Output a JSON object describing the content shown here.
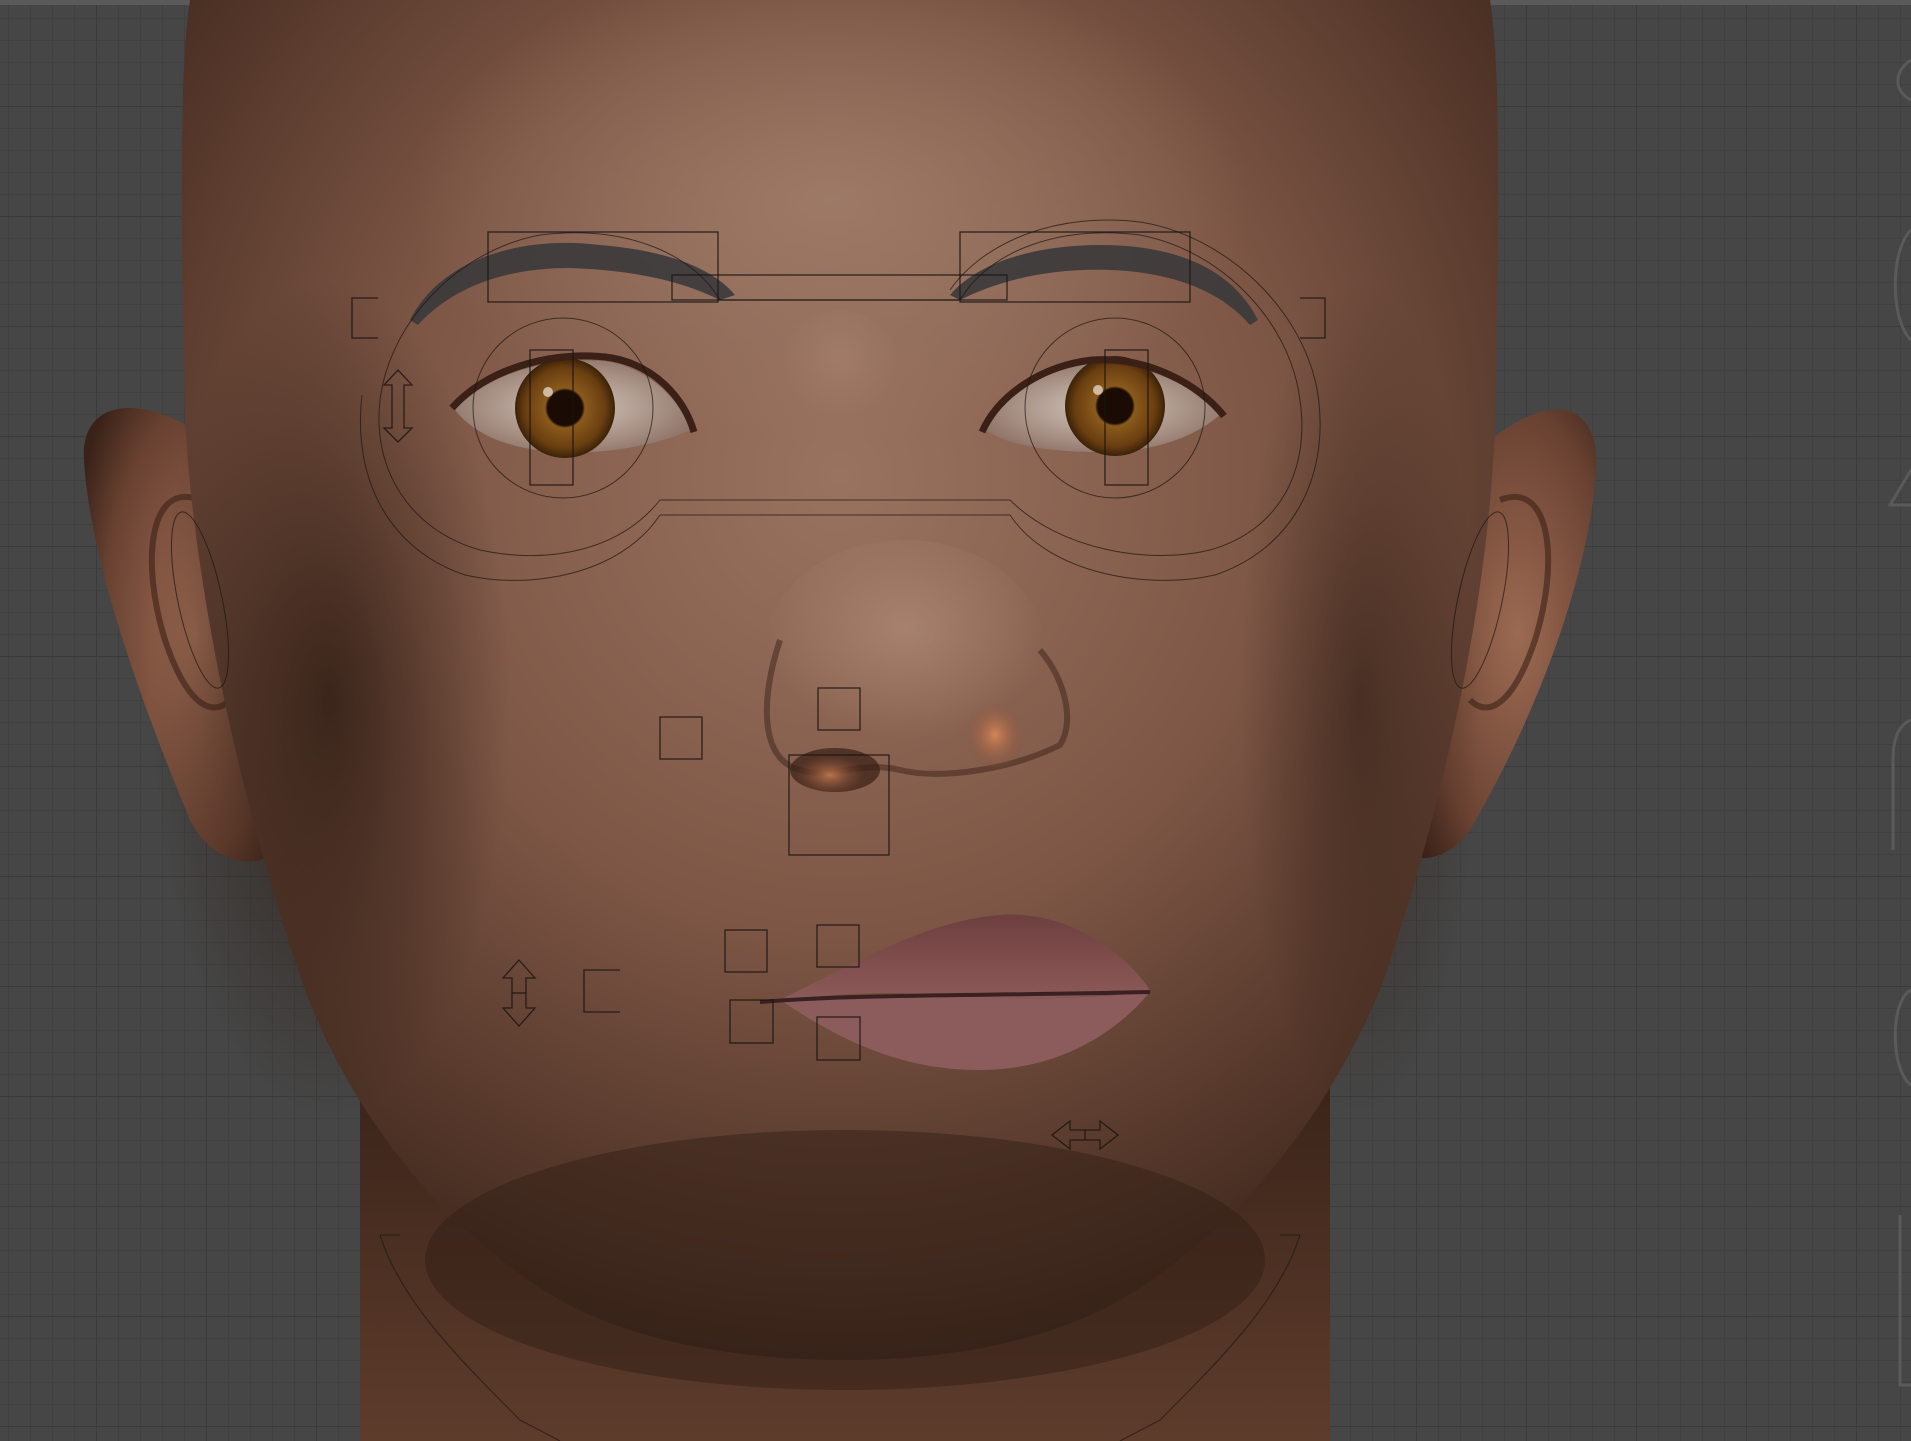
{
  "app": {
    "view": "face-rig-viewport"
  },
  "colors": {
    "viewport_bg": "#464646",
    "grid_major": "#3b3b3b",
    "grid_minor": "#404040",
    "skin_base": "#7a5443",
    "skin_highlight": "#a6806c",
    "skin_shadow": "#2e1c14",
    "iris": "#7a4a14",
    "lips": "#7b4a4c",
    "brow": "#3b3a3b",
    "rig_control": "#1a1512"
  },
  "controls": [
    {
      "name": "brow-left-control"
    },
    {
      "name": "brow-right-control"
    },
    {
      "name": "brow-center-control"
    },
    {
      "name": "eye-left-control"
    },
    {
      "name": "eye-right-control"
    },
    {
      "name": "eyes-ring-control"
    },
    {
      "name": "cheek-left-control"
    },
    {
      "name": "nose-control"
    },
    {
      "name": "nose-base-control"
    },
    {
      "name": "mouth-corner-control"
    },
    {
      "name": "upper-lip-control"
    },
    {
      "name": "lower-lip-control"
    },
    {
      "name": "jaw-vertical-arrow"
    },
    {
      "name": "jaw-horizontal-arrow"
    },
    {
      "name": "jaw-outline-control"
    },
    {
      "name": "ear-left-control"
    },
    {
      "name": "ear-right-control"
    }
  ]
}
